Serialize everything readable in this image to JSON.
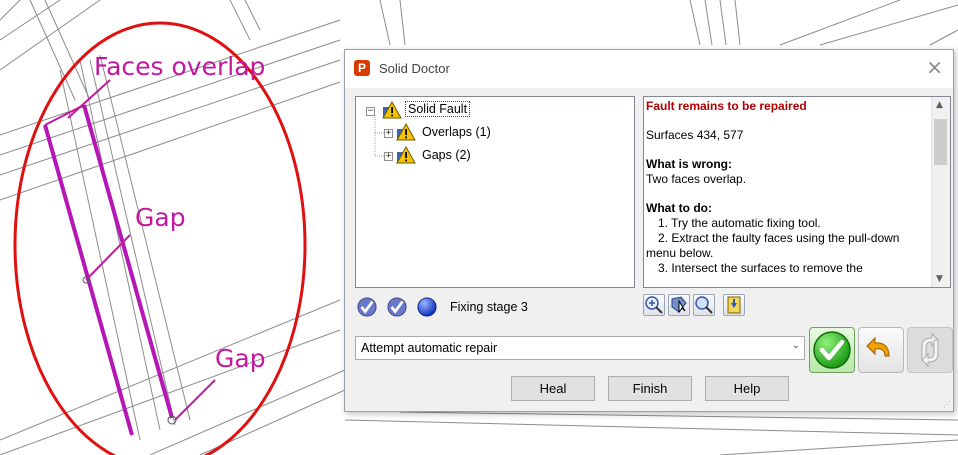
{
  "annotations": {
    "faces_overlap": "Faces overlap",
    "gap_1": "Gap",
    "gap_2": "Gap"
  },
  "dialog": {
    "title": "Solid Doctor",
    "app_icon_letter": "P",
    "close_symbol": "×",
    "tree": {
      "root": "Solid Fault",
      "children": [
        "Overlaps (1)",
        "Gaps (2)"
      ]
    },
    "info": {
      "heading": "Fault remains to be repaired",
      "surfaces": "Surfaces 434, 577",
      "wrong_heading": "What is wrong:",
      "wrong_text": "Two faces overlap.",
      "todo_heading": "What to do:",
      "steps": [
        "1. Try the automatic fixing tool.",
        "2. Extract the faulty faces using the pull-down",
        "menu below.",
        "3. Intersect the surfaces to remove the"
      ]
    },
    "stage_text": "Fixing stage 3",
    "combo_value": "Attempt automatic repair",
    "buttons": {
      "heal": "Heal",
      "finish": "Finish",
      "help": "Help"
    },
    "colors": {
      "accent_red": "#b00000",
      "annotation": "#c2189e",
      "ellipse": "#e01010"
    },
    "icons": {
      "tree": "warning-triangle-icon",
      "stages": [
        "check-stage-icon",
        "check-stage-icon",
        "blue-ball-icon"
      ],
      "toolbar": [
        "zoom-in-icon",
        "select-face-icon",
        "magnify-icon",
        "export-icon"
      ],
      "actions": [
        "apply-check-icon",
        "undo-arrow-icon",
        "redo-arrows-icon"
      ]
    }
  }
}
